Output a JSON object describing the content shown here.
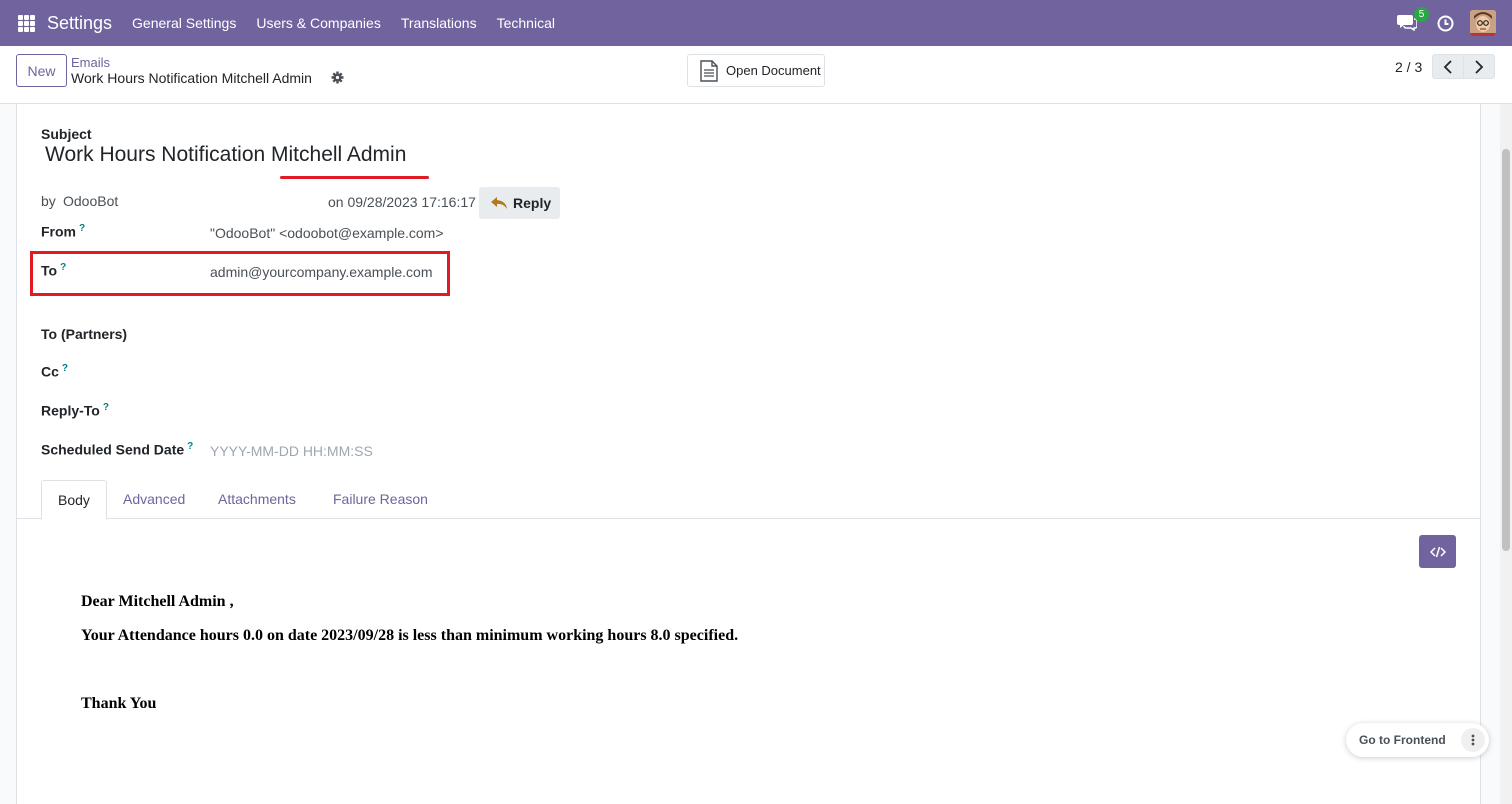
{
  "navbar": {
    "app_title": "Settings",
    "menu": [
      "General Settings",
      "Users & Companies",
      "Translations",
      "Technical"
    ],
    "chat_badge": "5"
  },
  "control_panel": {
    "new_label": "New",
    "breadcrumb_parent": "Emails",
    "breadcrumb_current": "Work Hours Notification Mitchell Admin",
    "open_document_label": "Open Document",
    "pager": "2 / 3"
  },
  "form": {
    "subject_label": "Subject",
    "subject_value": "Work Hours Notification Mitchell Admin",
    "by_label": "by",
    "author": "OdooBot",
    "date": "on 09/28/2023 17:16:17",
    "reply_label": "Reply",
    "from_label": "From",
    "from_value": "\"OdooBot\" <odoobot@example.com>",
    "to_label": "To",
    "to_value": "admin@yourcompany.example.com",
    "to_partners_label": "To (Partners)",
    "cc_label": "Cc",
    "reply_to_label": "Reply-To",
    "scheduled_label": "Scheduled Send Date",
    "scheduled_placeholder": "YYYY-MM-DD HH:MM:SS",
    "help_mark": "?"
  },
  "tabs": [
    "Body",
    "Advanced",
    "Attachments",
    "Failure Reason"
  ],
  "body": {
    "greeting": "Dear Mitchell Admin ,",
    "message": "Your Attendance hours 0.0 on date 2023/09/28 is less than minimum working hours 8.0 specified.",
    "closing": "Thank You"
  },
  "footer": {
    "go_to_frontend": "Go to Frontend"
  },
  "colors": {
    "brand": "#71639e",
    "highlight": "#e01b24"
  }
}
